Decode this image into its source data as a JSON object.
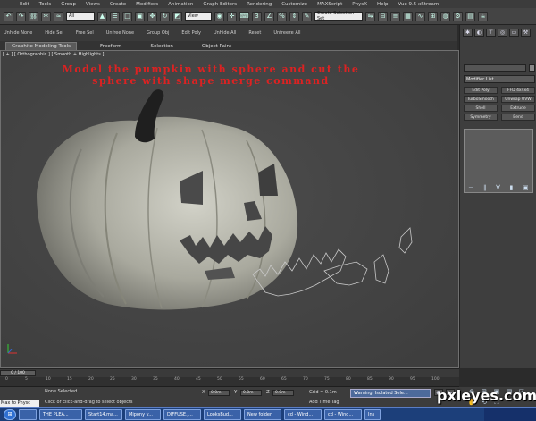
{
  "menubar": {
    "items": [
      "Edit",
      "Tools",
      "Group",
      "Views",
      "Create",
      "Modifiers",
      "Animation",
      "Graph Editors",
      "Rendering",
      "Customize",
      "MAXScript",
      "PhysX",
      "Help",
      "Vue 9.5 xStream"
    ]
  },
  "toolbar": {
    "selection_filter": "All",
    "reference_coord": "View",
    "named_selection": "Create Selection Set"
  },
  "toolbar2": {
    "items": [
      "Unhide None",
      "Hide Sel",
      "Free Sel",
      "Unfree None",
      "Group Obj",
      "Edit Poly",
      "Unhide All",
      "Reset",
      "Unfreeze All"
    ]
  },
  "ribbon": {
    "tabs": [
      "Graphite Modeling Tools",
      "Freeform",
      "Selection",
      "Object Paint"
    ]
  },
  "viewport": {
    "label": "[ + ] [ Orthographic ] [ Smooth + Highlights ]",
    "title_line1": "Model the pumpkin with sphere and cut the",
    "title_line2": "sphere with shape merge command"
  },
  "command_panel": {
    "modifier_list": "Modifier List",
    "buttons": [
      "Edit Poly",
      "FFD 4x4x4",
      "TurboSmooth",
      "Unwrap UVW",
      "Shell",
      "Extrude",
      "Symmetry",
      "Bend"
    ]
  },
  "timeline": {
    "slider": "0 / 100",
    "ticks": [
      "0",
      "5",
      "10",
      "15",
      "20",
      "25",
      "30",
      "35",
      "40",
      "45",
      "50",
      "55",
      "60",
      "65",
      "70",
      "75",
      "80",
      "85",
      "90",
      "95",
      "100"
    ]
  },
  "status": {
    "maxscript": "Max to Physc",
    "selection": "None Selected",
    "prompt": "Click or click-and-drag to select objects",
    "x_label": "X",
    "x_value": "0.0m",
    "y_label": "Y",
    "y_value": "0.0m",
    "z_label": "Z",
    "z_value": "0.0m",
    "grid": "Grid = 0.1m",
    "add_time_tag": "Add Time Tag",
    "warning": "Warning: Isolated Sele..."
  },
  "taskbar": {
    "items": [
      "",
      "THE PLEA...",
      "Start14.ma...",
      "Mipony v...",
      "DIFFUSE.j...",
      "LooksBud...",
      "New folder",
      "cd - Wind...",
      "cd - Wind...",
      "Ins"
    ]
  },
  "watermark": "pxleyes.com",
  "colors": {
    "viewport_bg": "#484848",
    "title_red": "#dd2222",
    "pumpkin": "#b8b8ac",
    "taskbar": "#1c3f7a"
  }
}
